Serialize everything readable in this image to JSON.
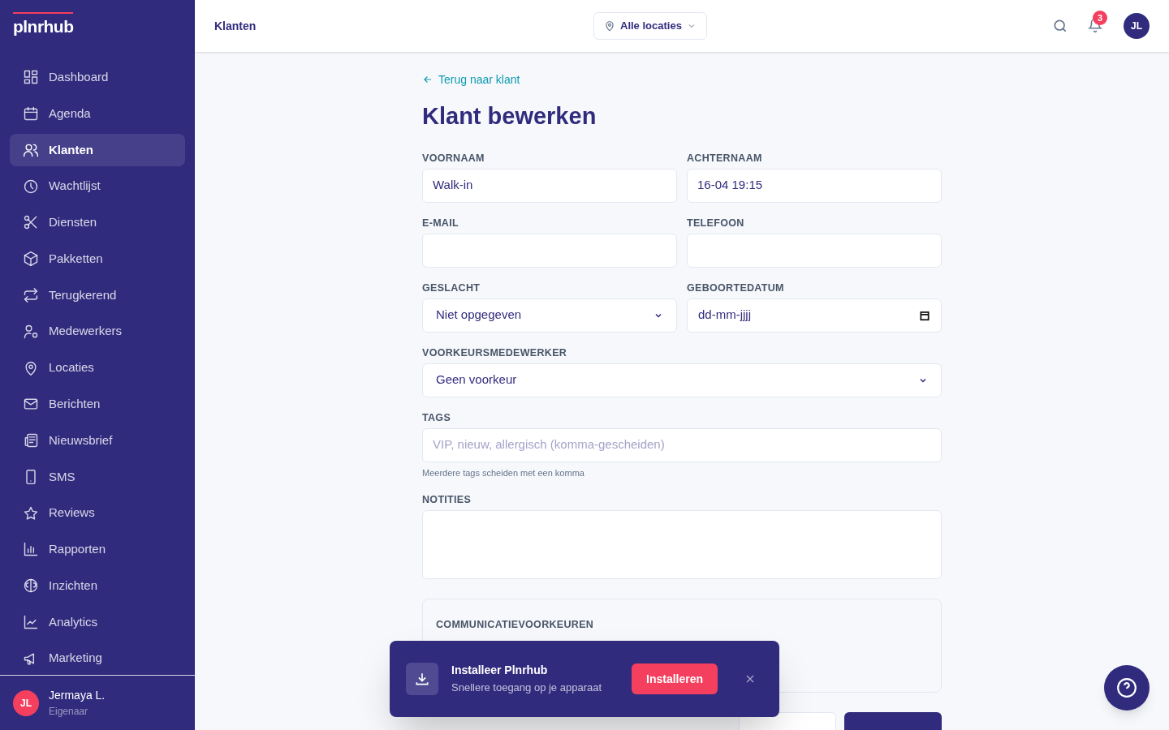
{
  "brand": {
    "logo": "plnrhub"
  },
  "sidebar": {
    "items": [
      {
        "label": "Dashboard",
        "selected": false
      },
      {
        "label": "Agenda",
        "selected": false
      },
      {
        "label": "Klanten",
        "selected": true
      },
      {
        "label": "Wachtlijst",
        "selected": false
      },
      {
        "label": "Diensten",
        "selected": false
      },
      {
        "label": "Pakketten",
        "selected": false
      },
      {
        "label": "Terugkerend",
        "selected": false
      },
      {
        "label": "Medewerkers",
        "selected": false
      },
      {
        "label": "Locaties",
        "selected": false
      },
      {
        "label": "Berichten",
        "selected": false
      },
      {
        "label": "Nieuwsbrief",
        "selected": false
      },
      {
        "label": "SMS",
        "selected": false
      },
      {
        "label": "Reviews",
        "selected": false
      },
      {
        "label": "Rapporten",
        "selected": false
      },
      {
        "label": "Inzichten",
        "selected": false
      },
      {
        "label": "Analytics",
        "selected": false
      },
      {
        "label": "Marketing",
        "selected": false
      }
    ],
    "user": {
      "initials": "JL",
      "name": "Jermaya L.",
      "role": "Eigenaar"
    }
  },
  "header": {
    "title": "Klanten",
    "location_filter": "Alle locaties",
    "notification_count": "3",
    "avatar": "JL"
  },
  "back_link": "Terug naar klant",
  "page_title": "Klant bewerken",
  "form_rows": [
    [
      {
        "kind": "text",
        "label": "VOORNAAM",
        "value": "Walk-in"
      },
      {
        "kind": "text",
        "label": "ACHTERNAAM",
        "value": "16-04 19:15"
      }
    ],
    [
      {
        "kind": "text",
        "label": "E-MAIL"
      },
      {
        "kind": "text",
        "label": "TELEFOON"
      }
    ],
    [
      {
        "kind": "select",
        "label": "GESLACHT",
        "value": "Niet opgegeven"
      },
      {
        "kind": "date",
        "label": "GEBOORTEDATUM",
        "value": "dd-mm-jjjj"
      }
    ],
    [
      {
        "kind": "select",
        "label": "VOORKEURSMEDEWERKER",
        "value": "Geen voorkeur"
      }
    ],
    [
      {
        "kind": "text",
        "label": "TAGS",
        "placeholder": "VIP, nieuw, allergisch (komma-gescheiden)",
        "hint": "Meerdere tags scheiden met een komma"
      }
    ],
    [
      {
        "kind": "textarea",
        "label": "NOTITIES"
      }
    ]
  ],
  "preferences_section": {
    "title": "COMMUNICATIEVOORKEUREN"
  },
  "install_banner": {
    "title": "Installeer Plnrhub",
    "subtitle": "Snellere toegang op je apparaat",
    "button": "Installeren"
  }
}
